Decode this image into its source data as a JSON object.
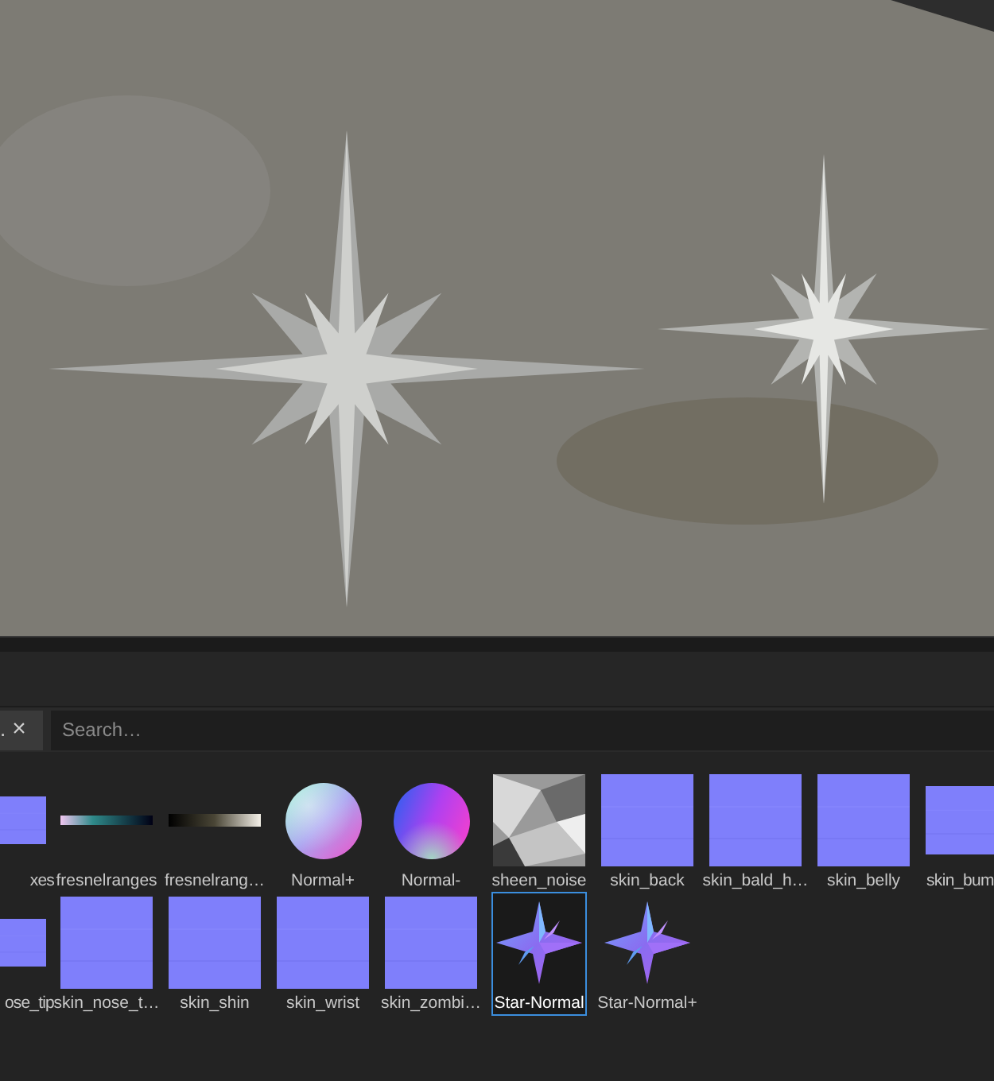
{
  "search": {
    "tag": ".",
    "close": "×",
    "placeholder": "Search…"
  },
  "rows": [
    {
      "items": [
        {
          "label": "xes",
          "kind": "normal",
          "selected": false
        },
        {
          "label": "fresnelranges",
          "kind": "gradient-color",
          "selected": false
        },
        {
          "label": "fresnelrang…",
          "kind": "gradient-gray",
          "selected": false
        },
        {
          "label": "Normal+",
          "kind": "sphere-plus",
          "selected": false
        },
        {
          "label": "Normal-",
          "kind": "sphere-minus",
          "selected": false
        },
        {
          "label": "sheen_noise",
          "kind": "noise",
          "selected": false
        },
        {
          "label": "skin_back",
          "kind": "normal",
          "selected": false
        },
        {
          "label": "skin_bald_h…",
          "kind": "normal",
          "selected": false
        },
        {
          "label": "skin_belly",
          "kind": "normal",
          "selected": false
        },
        {
          "label": "skin_bum",
          "kind": "normal",
          "selected": false
        }
      ]
    },
    {
      "items": [
        {
          "label": "ose_tip",
          "kind": "normal",
          "selected": false
        },
        {
          "label": "skin_nose_t…",
          "kind": "normal",
          "selected": false
        },
        {
          "label": "skin_shin",
          "kind": "normal",
          "selected": false
        },
        {
          "label": "skin_wrist",
          "kind": "normal",
          "selected": false
        },
        {
          "label": "skin_zombi…",
          "kind": "normal",
          "selected": false
        },
        {
          "label": "Star-Normal",
          "kind": "star",
          "selected": true
        },
        {
          "label": "Star-Normal+",
          "kind": "star",
          "selected": false
        }
      ]
    }
  ]
}
